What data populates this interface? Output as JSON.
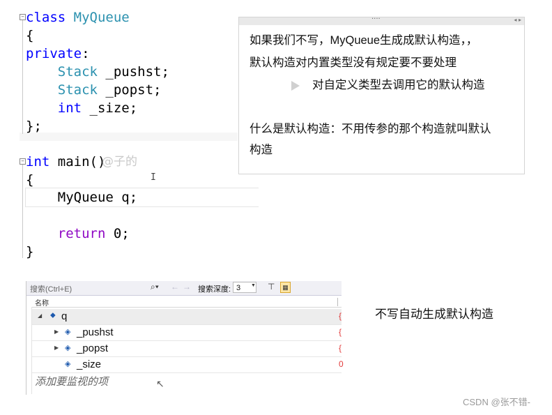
{
  "code": {
    "class_kw": "class",
    "class_name": "MyQueue",
    "open_brace": "{",
    "access": "private",
    "colon": ":",
    "members": [
      {
        "type": "Stack",
        "name": " _pushst;"
      },
      {
        "type": "Stack",
        "name": " _popst;"
      },
      {
        "type": "int",
        "name": " _size;"
      }
    ],
    "close_class": "};",
    "main_kw": "int",
    "main_sig": " main()",
    "ghost_text": "@子的",
    "main_open": "{",
    "decl_line": "    MyQueue q;",
    "return_kw": "return",
    "return_val": " 0;",
    "main_close": "}"
  },
  "notes": {
    "line1": "如果我们不写，MyQueue生成成默认构造，，",
    "line2": "默认构造对内置类型没有规定要不要处理",
    "bullet": "对自定义类型去调用它的默认构造",
    "line3": "什么是默认构造：不用传参的那个构造就叫默认",
    "line4": "构造",
    "dots": "····",
    "arrows": "◂ ▸"
  },
  "watch": {
    "search_placeholder": "搜索(Ctrl+E)",
    "depth_label": "搜索深度:",
    "depth_value": "3",
    "column_name": "名称",
    "rows": [
      {
        "name": "q",
        "expanded": true,
        "indent": 0
      },
      {
        "name": "_pushst",
        "expanded": false,
        "indent": 1
      },
      {
        "name": "_popst",
        "expanded": false,
        "indent": 1
      },
      {
        "name": "_size",
        "expanded": null,
        "indent": 1
      }
    ],
    "add_item": "添加要监视的项"
  },
  "side_note": "不写自动生成默认构造",
  "watermark": "CSDN @张不错-"
}
